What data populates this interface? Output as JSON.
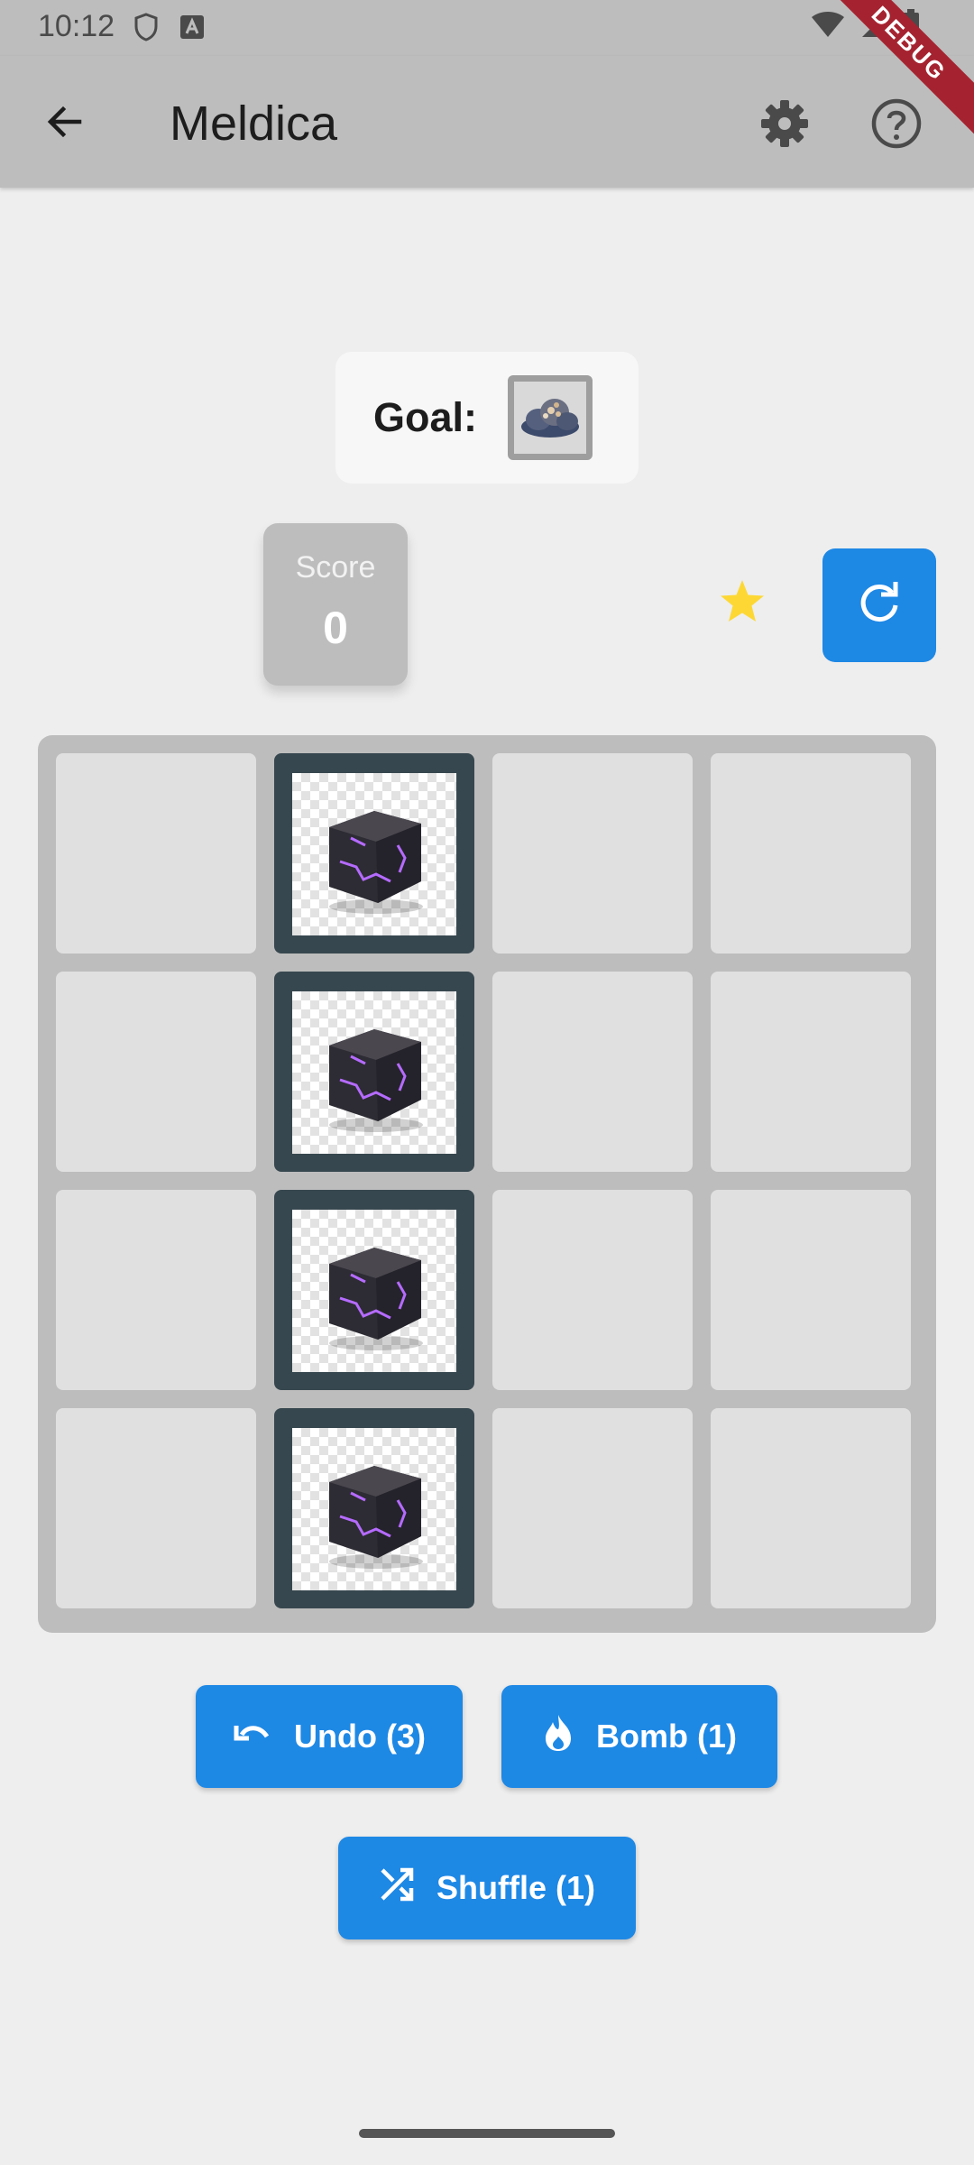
{
  "status_bar": {
    "time": "10:12"
  },
  "app_bar": {
    "title": "Meldica",
    "debug_label": "DEBUG"
  },
  "goal": {
    "label": "Goal:"
  },
  "score": {
    "label": "Score",
    "value": "0"
  },
  "buttons": {
    "undo": "Undo (3)",
    "bomb": "Bomb (1)",
    "shuffle": "Shuffle (1)"
  },
  "board": {
    "rows": 4,
    "cols": 4,
    "cells": [
      [
        "empty",
        "cracked-cube",
        "empty",
        "empty"
      ],
      [
        "empty",
        "cracked-cube",
        "empty",
        "empty"
      ],
      [
        "empty",
        "cracked-cube",
        "empty",
        "empty"
      ],
      [
        "empty",
        "cracked-cube",
        "empty",
        "empty"
      ]
    ]
  },
  "colors": {
    "accent": "#1e88e5",
    "app_bar": "#bdbdbd",
    "filled_tile": "#37474f",
    "empty_tile": "#e0e0e0",
    "star": "#fdd835"
  }
}
